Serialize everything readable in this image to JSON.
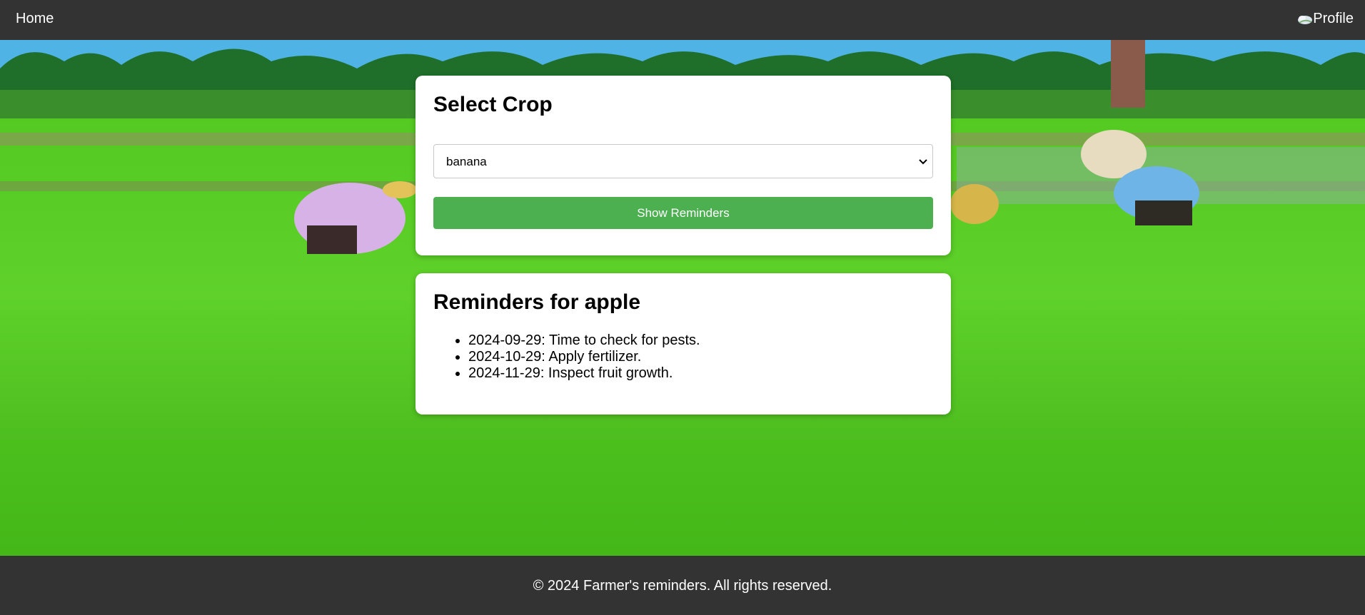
{
  "nav": {
    "home": "Home",
    "profile": "Profile"
  },
  "select_card": {
    "title": "Select Crop",
    "selected": "banana",
    "button": "Show Reminders"
  },
  "reminders_card": {
    "title": "Reminders for apple",
    "items": [
      "2024-09-29: Time to check for pests.",
      "2024-10-29: Apply fertilizer.",
      "2024-11-29: Inspect fruit growth."
    ]
  },
  "footer": {
    "text": "© 2024 Farmer's reminders. All rights reserved."
  },
  "colors": {
    "nav": "#333333",
    "button": "#4caf50",
    "grass": "#5fd12a",
    "sky": "#4fb3e6"
  }
}
